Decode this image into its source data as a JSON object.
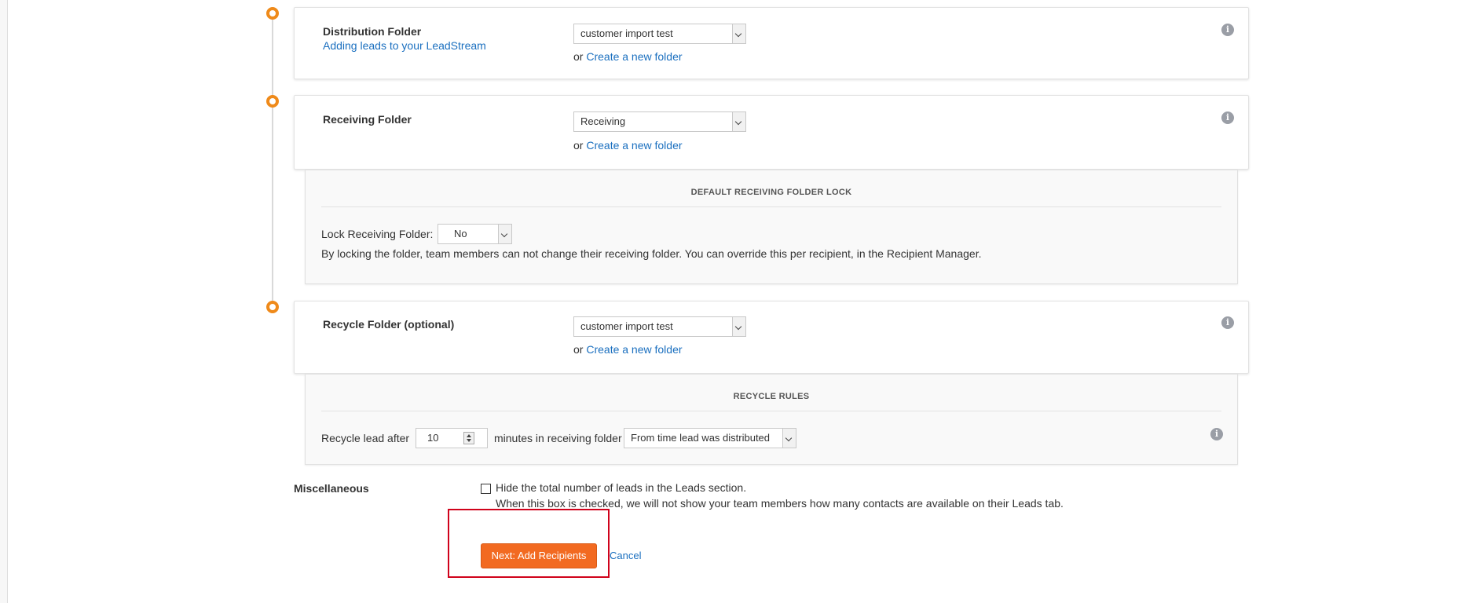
{
  "distribution": {
    "title": "Distribution Folder",
    "help_link": "Adding leads to your LeadStream",
    "selected": "customer import test",
    "or_text": "or",
    "create_link": "Create a new folder"
  },
  "receiving": {
    "title": "Receiving Folder",
    "selected": "Receiving",
    "or_text": "or",
    "create_link": "Create a new folder",
    "lock_section": {
      "heading": "DEFAULT RECEIVING FOLDER LOCK",
      "label": "Lock Receiving Folder:",
      "selected": "No",
      "description": "By locking the folder, team members can not change their receiving folder. You can override this per recipient, in the Recipient Manager."
    }
  },
  "recycle": {
    "title": "Recycle Folder (optional)",
    "selected": "customer import test",
    "or_text": "or",
    "create_link": "Create a new folder",
    "rules": {
      "heading": "RECYCLE RULES",
      "prefix": "Recycle lead after",
      "minutes_value": "10",
      "middle": "minutes in receiving folder",
      "basis_selected": "From time lead was distributed"
    }
  },
  "misc": {
    "label": "Miscellaneous",
    "checkbox_label": "Hide the total number of leads in the Leads section.",
    "checkbox_checked": false,
    "description": "When this box is checked, we will not show your team members how many contacts are available on their Leads tab."
  },
  "actions": {
    "next_label": "Next: Add Recipients",
    "cancel_label": "Cancel"
  },
  "icons": {
    "info": "i"
  },
  "colors": {
    "accent_orange": "#f26a21",
    "timeline_orange": "#ef8a1a",
    "link_blue": "#1a6fbf",
    "highlight_red": "#d0021b"
  }
}
